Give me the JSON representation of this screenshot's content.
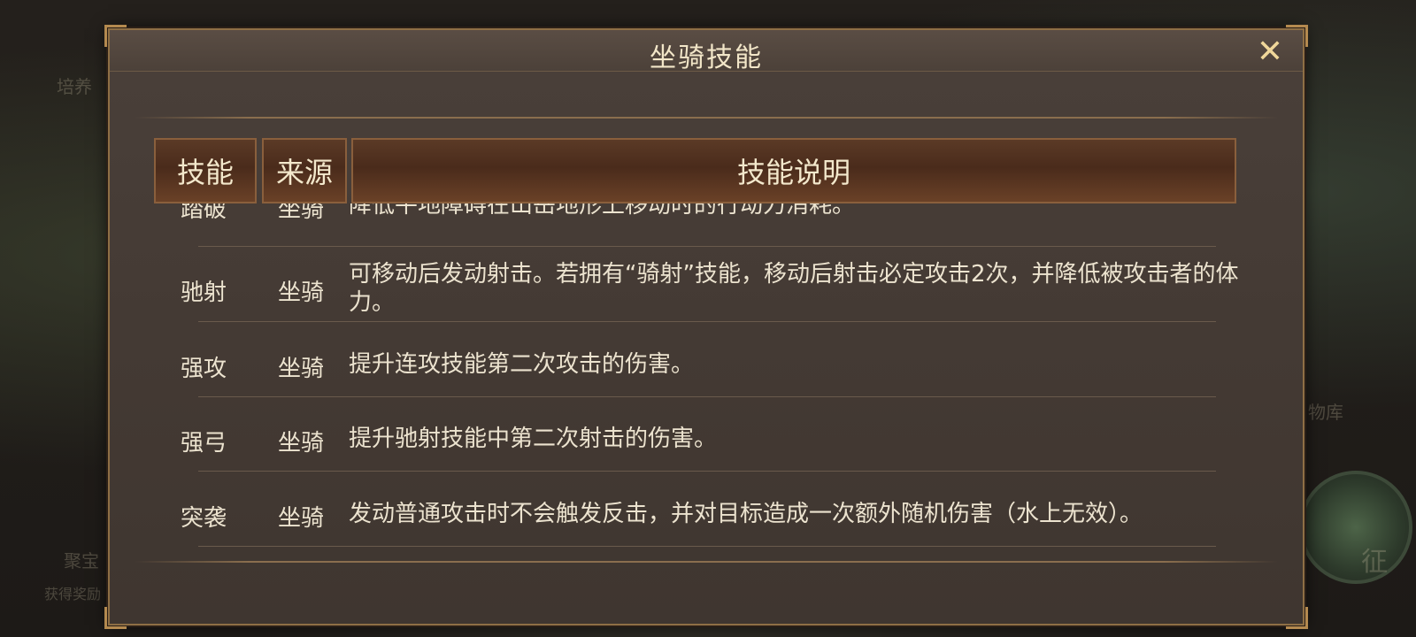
{
  "background": {
    "top_left_text": "培养",
    "left_text_1": "聚宝",
    "left_text_2": "获得奖励",
    "right_text_1": "物库",
    "right_text_2": "征"
  },
  "dialog": {
    "title": "坐骑技能",
    "close_icon": "close-icon"
  },
  "table": {
    "headers": [
      "技能",
      "来源",
      "技能说明"
    ],
    "rows": [
      {
        "skill": "踏破",
        "source": "坐骑",
        "desc": "降低平地障碍在山岳地形上移动时的行动力消耗。"
      },
      {
        "skill": "驰射",
        "source": "坐骑",
        "desc": "可移动后发动射击。若拥有“骑射”技能，移动后射击必定攻击2次，并降低被攻击者的体力。"
      },
      {
        "skill": "强攻",
        "source": "坐骑",
        "desc": "提升连攻技能第二次攻击的伤害。"
      },
      {
        "skill": "强弓",
        "source": "坐骑",
        "desc": "提升驰射技能中第二次射击的伤害。"
      },
      {
        "skill": "突袭",
        "source": "坐骑",
        "desc": "发动普通攻击时不会触发反击，并对目标造成一次额外随机伤害（水上无效）。"
      }
    ]
  },
  "colors": {
    "frame": "#8e6f45",
    "title_text": "#f2e6c8",
    "body_text": "#ece3cf",
    "header_fill": "#5b3a26"
  }
}
